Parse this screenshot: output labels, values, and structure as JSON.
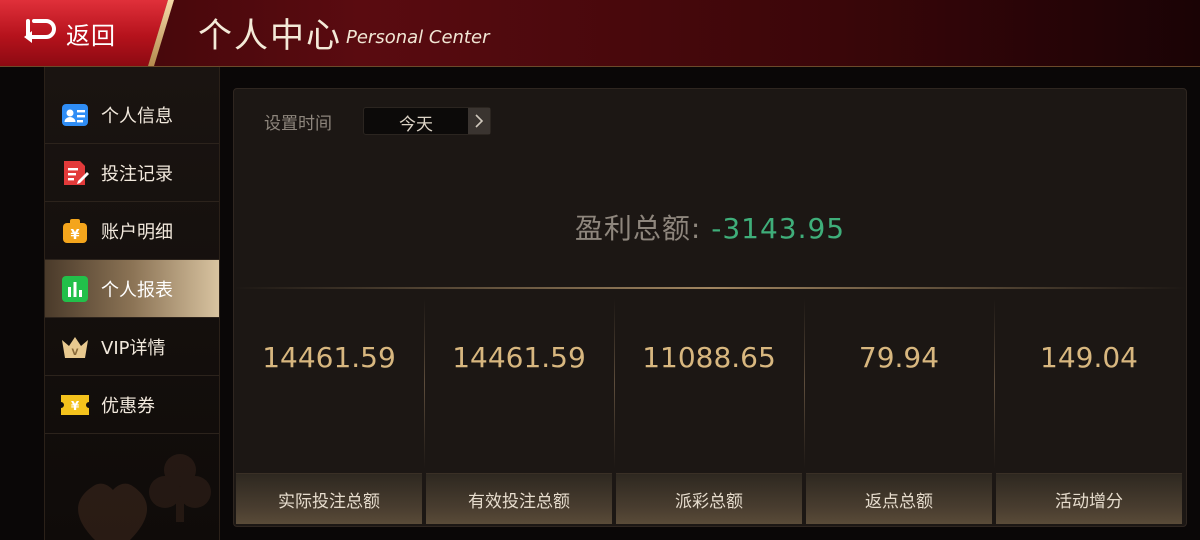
{
  "header": {
    "back_label": "返回",
    "title_cn": "个人中心",
    "title_en": "Personal Center"
  },
  "sidebar": {
    "items": [
      {
        "label": "个人信息",
        "icon": "id-card-icon",
        "color": "#2f8df5"
      },
      {
        "label": "投注记录",
        "icon": "bet-record-icon",
        "color": "#e23a3a"
      },
      {
        "label": "账户明细",
        "icon": "yen-bag-icon",
        "color": "#f4a51c"
      },
      {
        "label": "个人报表",
        "icon": "bar-chart-icon",
        "color": "#22c04a",
        "active": true
      },
      {
        "label": "VIP详情",
        "icon": "vip-crown-icon",
        "color": "#e8c98f"
      },
      {
        "label": "优惠券",
        "icon": "coupon-icon",
        "color": "#f4c21c"
      }
    ]
  },
  "filter": {
    "label": "设置时间",
    "value": "今天"
  },
  "profit": {
    "label": "盈利总额:",
    "value": "-3143.95"
  },
  "stats": [
    {
      "value": "14461.59",
      "label": "实际投注总额"
    },
    {
      "value": "14461.59",
      "label": "有效投注总额"
    },
    {
      "value": "11088.65",
      "label": "派彩总额"
    },
    {
      "value": "79.94",
      "label": "返点总额"
    },
    {
      "value": "149.04",
      "label": "活动增分"
    }
  ],
  "colors": {
    "profit_negative": "#3fae7a",
    "stat_value": "#d8b77f",
    "header_red": "#b5121c"
  }
}
